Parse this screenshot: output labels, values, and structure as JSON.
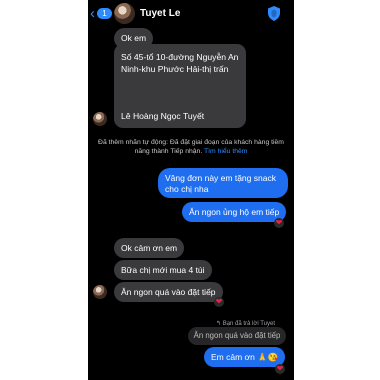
{
  "header": {
    "back_glyph": "‹",
    "unread_count": "1",
    "contact_name": "Tuyet Le",
    "shield_icon": "shield-icon"
  },
  "messages": {
    "ok_em": "Ok em",
    "address": "Số 45-tổ 10-đường Nguyễn An Ninh-khu Phước Hải-thị trấn",
    "customer_name": "Lê Hoàng Ngọc Tuyết",
    "system_notice": "Đã thêm nhãn tự động: Đã đặt giai đoạn của khách hàng tiềm năng thành Tiếp nhận.",
    "system_link": "Tìm hiểu thêm",
    "out1": "Vâng đơn này em tặng snack cho chị nha",
    "out2": "Ăn ngon ủng hộ em tiếp",
    "in1": "Ok cảm ơn em",
    "in2": "Bữa chị mới mua 4 túi",
    "in3": "Ăn ngon quá vào đặt tiếp",
    "reply_label": "↰ Bạn đã trả lời Tuyet",
    "reply_quote": "Ăn ngon quá vào đặt tiếp",
    "out3": "Em cảm ơn 🙏😘",
    "heart": "❤"
  },
  "colors": {
    "incoming_bubble": "#3a3a3c",
    "outgoing_bubble": "#1f6ef0",
    "accent": "#2e8cff"
  }
}
